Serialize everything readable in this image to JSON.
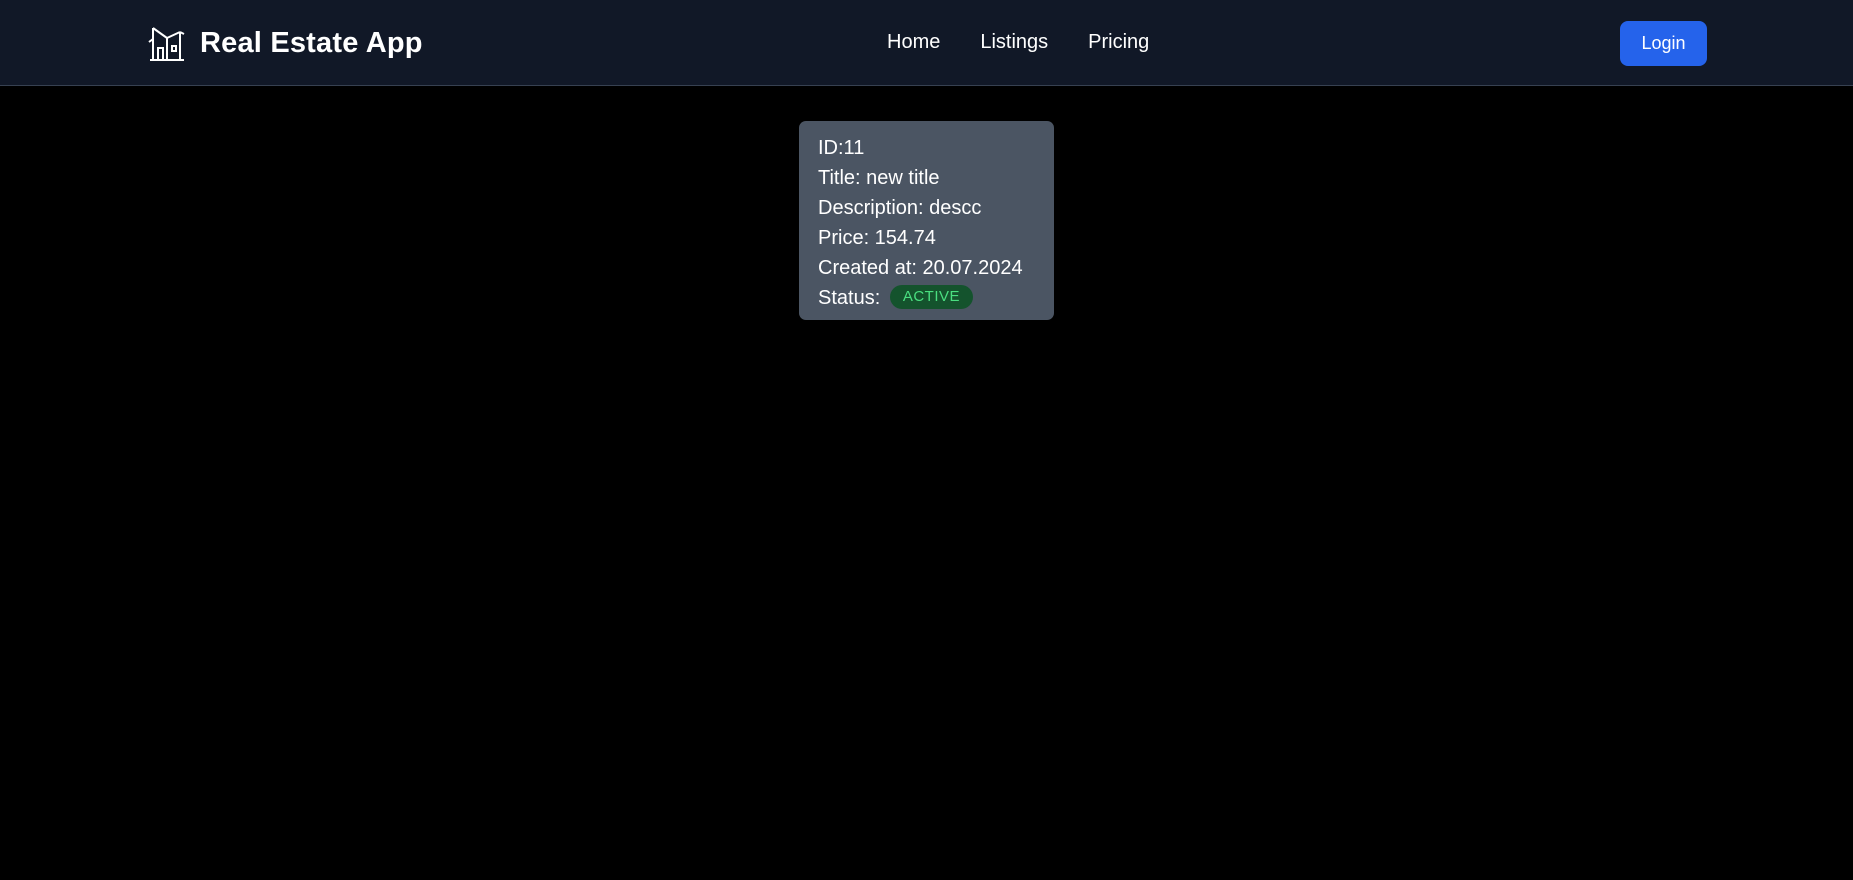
{
  "app": {
    "title": "Real Estate App",
    "logo_icon": "building-icon"
  },
  "nav": {
    "links": [
      {
        "label": "Home"
      },
      {
        "label": "Listings"
      },
      {
        "label": "Pricing"
      }
    ],
    "login_label": "Login"
  },
  "listing": {
    "id_line": "ID:11",
    "title_line": "Title: new title",
    "description_line": "Description: descc",
    "price_line": "Price: 154.74",
    "created_line": "Created at: 20.07.2024",
    "status_label": "Status:",
    "status_value": "ACTIVE"
  },
  "colors": {
    "page_background": "#000000",
    "navbar_background": "#111827",
    "card_background": "#4b5563",
    "login_button": "#2563eb",
    "status_badge_bg": "#14532d",
    "status_badge_text": "#4ade80"
  }
}
